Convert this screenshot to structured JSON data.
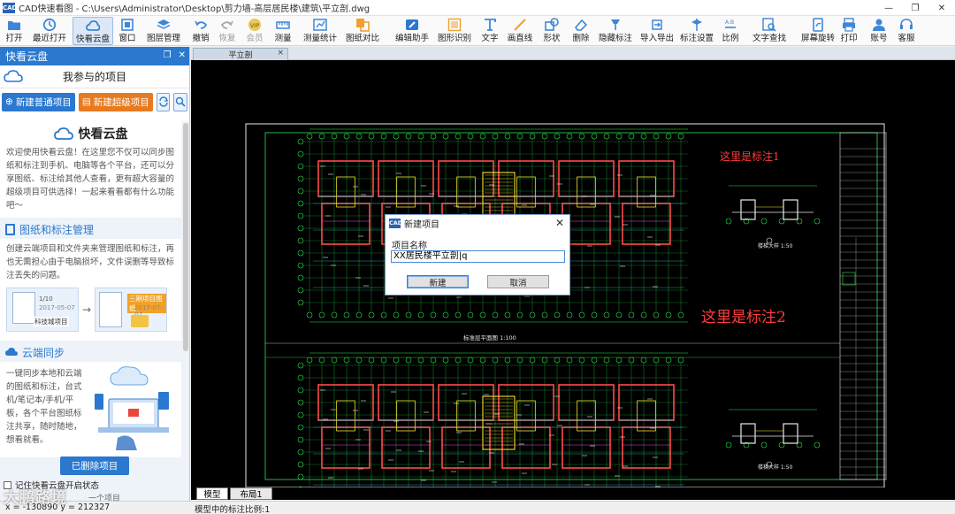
{
  "window": {
    "logo_text": "CAD",
    "title": "CAD快速看图 - C:\\Users\\Administrator\\Desktop\\剪力墙-高层居民楼\\建筑\\平立剖.dwg",
    "minimize": "—",
    "maximize": "❐",
    "close": "✕"
  },
  "toolbar": {
    "items": [
      {
        "label": "打开",
        "icon": "open-icon"
      },
      {
        "label": "最近打开",
        "icon": "recent-icon"
      },
      {
        "label": "快看云盘",
        "icon": "cloud-icon",
        "active": true
      },
      {
        "label": "窗口",
        "icon": "window-icon"
      },
      {
        "label": "图层管理",
        "icon": "layers-icon"
      },
      {
        "label": "撤销",
        "icon": "undo-icon"
      },
      {
        "label": "恢复",
        "icon": "redo-icon",
        "disabled": true
      },
      {
        "label": "会员",
        "icon": "vip-icon",
        "disabled": true
      },
      {
        "label": "测量",
        "icon": "measure-icon"
      },
      {
        "label": "测量统计",
        "icon": "measure-stats-icon"
      },
      {
        "label": "图纸对比",
        "icon": "compare-icon"
      },
      {
        "label": "编辑助手",
        "icon": "edit-assist-icon"
      },
      {
        "label": "图形识别",
        "icon": "shape-recognize-icon"
      },
      {
        "label": "文字",
        "icon": "text-icon"
      },
      {
        "label": "画直线",
        "icon": "line-icon"
      },
      {
        "label": "形状",
        "icon": "shape-icon"
      },
      {
        "label": "删除",
        "icon": "eraser-icon"
      },
      {
        "label": "隐藏标注",
        "icon": "hide-annotation-icon"
      },
      {
        "label": "导入导出",
        "icon": "import-export-icon"
      },
      {
        "label": "标注设置",
        "icon": "annotation-settings-icon"
      },
      {
        "label": "比例",
        "icon": "scale-icon"
      },
      {
        "label": "文字查找",
        "icon": "text-search-icon"
      },
      {
        "label": "屏幕旋转",
        "icon": "rotate-screen-icon"
      },
      {
        "label": "打印",
        "icon": "print-icon"
      },
      {
        "label": "账号",
        "icon": "account-icon"
      },
      {
        "label": "客服",
        "icon": "support-icon"
      }
    ]
  },
  "left_panel": {
    "header": "快看云盘",
    "subtitle": "我参与的项目",
    "new_normal_project": "新建普通项目",
    "new_super_project": "新建超级项目",
    "welcome_title": "快看云盘",
    "welcome_text": "欢迎使用快看云盘！在这里您不仅可以同步图纸和标注到手机、电脑等各个平台，还可以分享图纸、标注给其他人查看，更有超大容量的超级项目可供选择！一起来看看都有什么功能吧～",
    "section1_title": "图纸和标注管理",
    "section1_text": "创建云端项目和文件夹来管理图纸和标注，再也无需担心由于电脑损坏，文件误删等导致标注丢失的问题。",
    "ill_left_line1": "1/10",
    "ill_left_line2": "2017-05-07",
    "ill_left_tag": "科技城项目",
    "ill_right_tag": "三期项目图纸",
    "ill_right_date": "2017-07-07",
    "section2_title": "云端同步",
    "section2_text": "一键同步本地和云端的图纸和标注，台式机/笔记本/手机/平板，各个平台图纸标注共享，随时随地，想看就看。",
    "deleted_projects": "已删除项目",
    "remember_state": "记住快看云盘开启状态",
    "footer_hint": "一个项目"
  },
  "tabs": {
    "active_doc": "平立剖",
    "close": "×",
    "model": "模型",
    "layout1": "布局1"
  },
  "drawing": {
    "annotation1": "这里是标注1",
    "annotation2": "这里是标注2",
    "plan_caption": "标准层平面图 1:100",
    "detail_caption1": "楼梯大样 1:50",
    "detail_caption2": "楼梯大样 1:50",
    "colors": {
      "wall": "#ff4a4a",
      "green": "#27e84a",
      "yellow": "#f5e62a",
      "cyan": "#2fd7e8",
      "white": "#e8e8e8",
      "magenta": "#ff3cf0"
    }
  },
  "dialog": {
    "title": "新建项目",
    "close": "✕",
    "label": "项目名称",
    "value": "XX居民楼平立剖|q",
    "ok": "新建",
    "cancel": "取消"
  },
  "statusbar": {
    "coords": "x = -130890  y = 212327",
    "scale_text": "模型中的标注比例:1",
    "watermark": "大鹏路境"
  }
}
